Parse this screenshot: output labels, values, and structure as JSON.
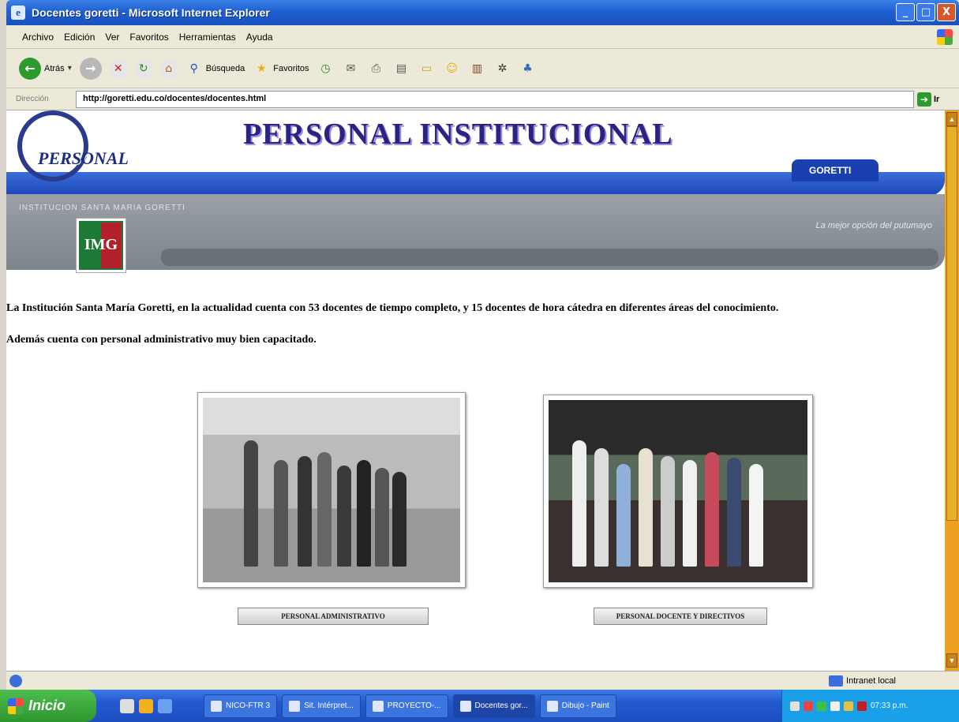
{
  "window": {
    "title": "Docentes goretti - Microsoft Internet Explorer",
    "min": "_",
    "max": "□",
    "close": "X"
  },
  "menu": [
    "Archivo",
    "Edición",
    "Ver",
    "Favoritos",
    "Herramientas",
    "Ayuda"
  ],
  "toolbar": {
    "back_label": "Atrás",
    "search_label": "Búsqueda",
    "favorites_label": "Favoritos"
  },
  "address": {
    "label": "Dirección",
    "url": "http://goretti.edu.co/docentes/docentes.html",
    "go_label": "Ir"
  },
  "banner": {
    "logo_word": "PERSONAL",
    "title": "PERSONAL INSTITUCIONAL",
    "tab": "GORETTI",
    "institution": "INSTITUCION SANTA MARIA GORETTI",
    "slogan": "La mejor opción del putumayo",
    "shield_text": "IMG"
  },
  "content": {
    "paragraph1": "La Institución Santa María Goretti, en la actualidad cuenta con 53 docentes de tiempo completo, y 15 docentes de hora cátedra en diferentes áreas del conocimiento.",
    "paragraph2": "Además cuenta con personal administrativo muy bien capacitado."
  },
  "links": {
    "admin": "PERSONAL ADMINISTRATIVO",
    "docentes": "PERSONAL DOCENTE Y DIRECTIVOS"
  },
  "status": {
    "zone": "Intranet local"
  },
  "taskbar": {
    "start": "Inicio",
    "tasks": [
      "NICO-FTR 3",
      "Sit. Intérpret...",
      "PROYECTO-...",
      "Docentes gor...",
      "Dibujo - Paint"
    ],
    "clock": "07:33 p.m."
  },
  "colors": {
    "titlebar": "#1f5fd0",
    "banner_blue": "#1c46b8",
    "banner_grey": "#7d848b",
    "heading": "#2b2380",
    "scrollbar": "#f0a020"
  }
}
